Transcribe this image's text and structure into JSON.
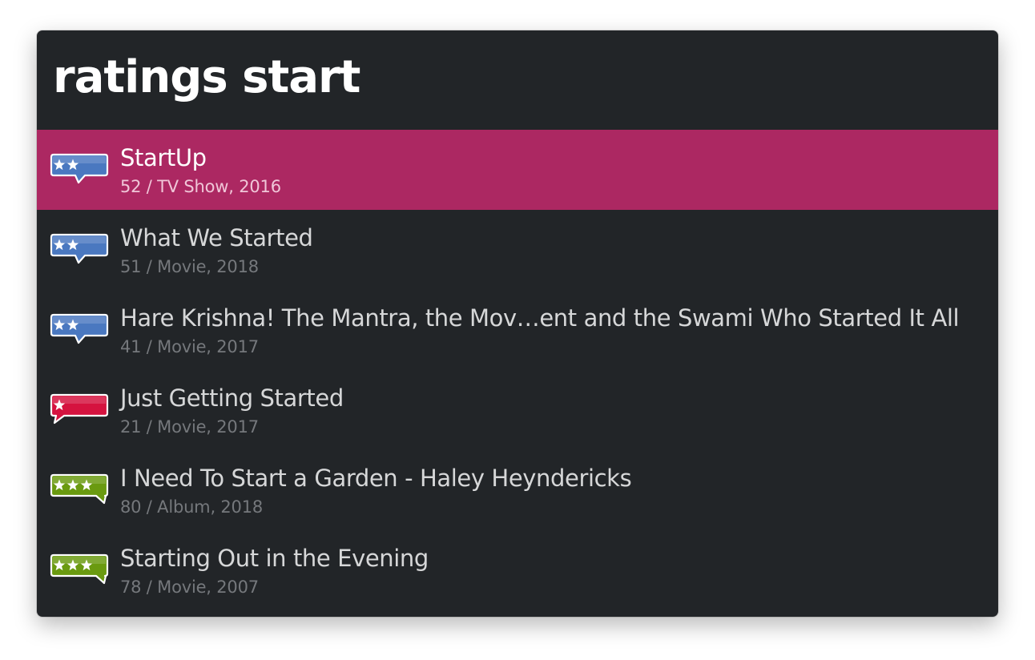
{
  "query": {
    "text": "ratings start"
  },
  "results": [
    {
      "title": "StartUp",
      "subtitle": "52 / TV Show, 2016",
      "icon": "rating-two-star-blue-icon",
      "stars": 2,
      "color": "#4a78c0",
      "selected": true
    },
    {
      "title": "What We Started",
      "subtitle": "51 / Movie, 2018",
      "icon": "rating-two-star-blue-icon",
      "stars": 2,
      "color": "#4a78c0",
      "selected": false
    },
    {
      "title": "Hare Krishna! The Mantra, the Mov…ent and the Swami Who Started It All",
      "subtitle": "41 / Movie, 2017",
      "icon": "rating-two-star-blue-icon",
      "stars": 2,
      "color": "#4a78c0",
      "selected": false
    },
    {
      "title": "Just Getting Started",
      "subtitle": "21 / Movie, 2017",
      "icon": "rating-one-star-red-icon",
      "stars": 1,
      "color": "#d5133f",
      "selected": false
    },
    {
      "title": "I Need To Start a Garden - Haley Heyndericks",
      "subtitle": "80 / Album, 2018",
      "icon": "rating-three-star-green-icon",
      "stars": 3,
      "color": "#6a9a10",
      "selected": false
    },
    {
      "title": "Starting Out in the Evening",
      "subtitle": "78 / Movie, 2007",
      "icon": "rating-three-star-green-icon",
      "stars": 3,
      "color": "#6a9a10",
      "selected": false
    }
  ],
  "colors": {
    "window_bg": "#222528",
    "selection_bg": "#ac2862",
    "title_text": "#d6d7d8",
    "subtitle_text": "#75787c"
  }
}
